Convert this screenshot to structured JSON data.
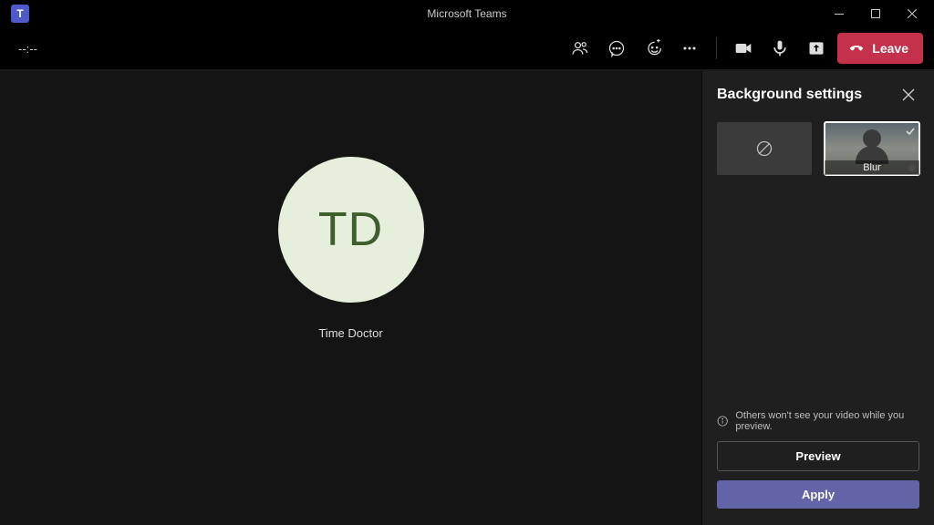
{
  "titlebar": {
    "title": "Microsoft Teams"
  },
  "toolbar": {
    "timer": "--:--",
    "leave_label": "Leave"
  },
  "participant": {
    "initials": "TD",
    "name": "Time Doctor"
  },
  "panel": {
    "title": "Background settings",
    "options": {
      "blur_label": "Blur"
    },
    "info": "Others won't see your video while you preview.",
    "preview_label": "Preview",
    "apply_label": "Apply"
  }
}
